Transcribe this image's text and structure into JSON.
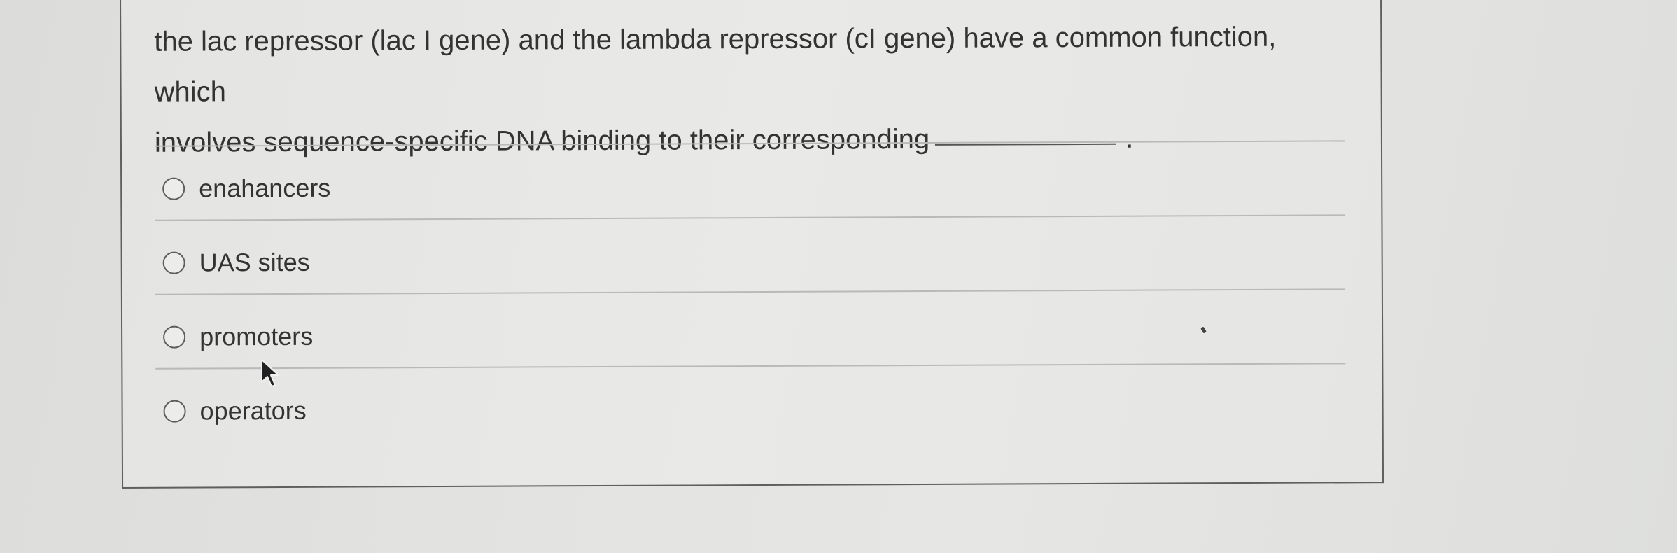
{
  "question": {
    "text_line1": "the lac repressor (lac I gene) and the lambda repressor (cI gene) have a common function, which",
    "text_line2": "involves sequence-specific DNA binding to their corresponding",
    "trailing_period": "."
  },
  "options": [
    {
      "label": "enahancers",
      "selected": false
    },
    {
      "label": "UAS sites",
      "selected": false
    },
    {
      "label": "promoters",
      "selected": false
    },
    {
      "label": "operators",
      "selected": false
    }
  ],
  "colors": {
    "background": "#e3e3e1",
    "card": "#e8e8e6",
    "text": "#333333",
    "border": "#5f5f5f",
    "separator": "#b9b9b7"
  },
  "icons": {
    "cursor": "mouse-pointer-icon",
    "radio": "radio-unchecked-icon"
  }
}
